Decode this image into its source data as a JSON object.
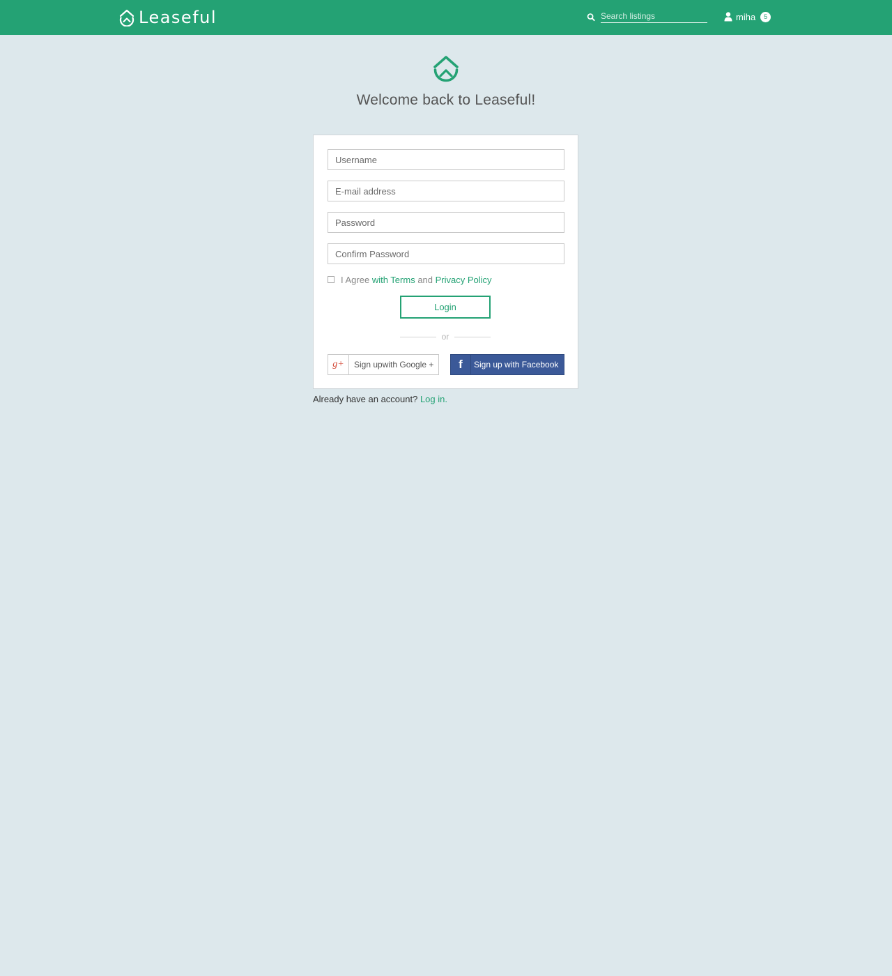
{
  "app": {
    "brand_name": "Leaseful",
    "accent_color": "#24a274",
    "background_color": "#dde8ec"
  },
  "header": {
    "search": {
      "placeholder": "Search listings",
      "icon": "search-icon"
    },
    "user": {
      "name": "miha",
      "icon": "user-icon",
      "notification_count": "5"
    }
  },
  "main": {
    "logo_icon": "house-logo-icon",
    "welcome": "Welcome back to Leaseful!"
  },
  "form": {
    "username_placeholder": "Username",
    "email_placeholder": "E-mail address",
    "password_placeholder": "Password",
    "confirm_password_placeholder": "Confirm Password",
    "agree": {
      "prefix": "I Agree ",
      "terms_link": "with Terms",
      "middle": " and ",
      "privacy_link": "Privacy Policy"
    },
    "login_label": "Login",
    "divider_text": "or",
    "google": {
      "icon_text": "g+",
      "label": "Sign upwith Google +"
    },
    "facebook": {
      "icon_text": "f",
      "label": "Sign up with Facebook",
      "color": "#3b5998"
    }
  },
  "footer": {
    "prompt": "Already have an account?",
    "login_link": "Log in."
  }
}
